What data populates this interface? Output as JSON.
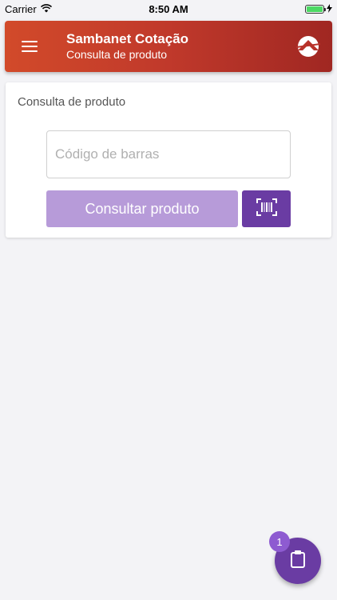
{
  "status_bar": {
    "carrier": "Carrier",
    "time": "8:50 AM",
    "icons": [
      "wifi-icon",
      "battery-icon",
      "charging-icon"
    ]
  },
  "app_bar": {
    "title": "Sambanet Cotação",
    "subtitle": "Consulta de produto",
    "icons": [
      "menu-icon",
      "logo-icon"
    ],
    "colors": {
      "start": "#d24a2a",
      "end": "#a02722"
    }
  },
  "card": {
    "title": "Consulta de produto",
    "input": {
      "value": "",
      "placeholder": "Código de barras"
    },
    "consult_button": "Consultar produto",
    "scan_icon": "barcode-scan-icon"
  },
  "fab": {
    "icon": "clipboard-icon",
    "badge": "1"
  },
  "colors": {
    "accent": "#6a3ca3",
    "accent_light": "#b79bd9",
    "background": "#f3f3f6"
  }
}
